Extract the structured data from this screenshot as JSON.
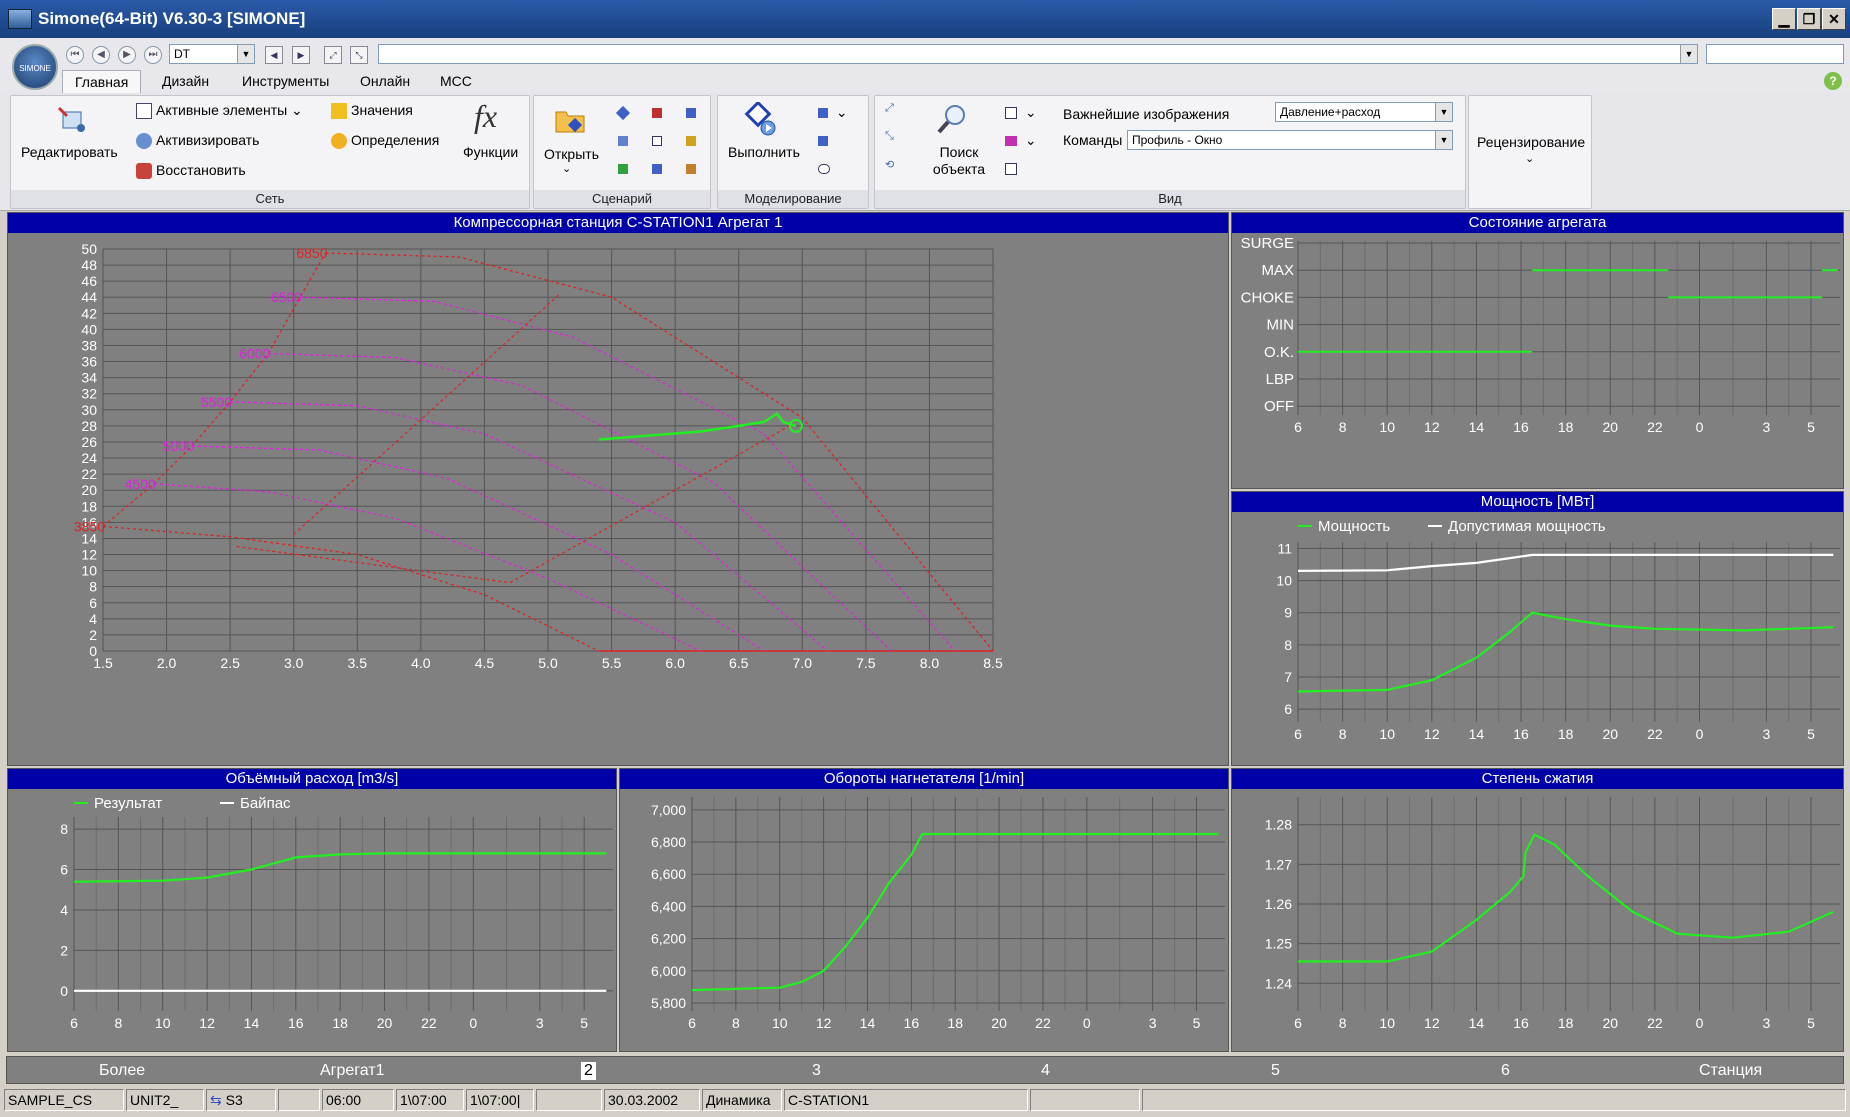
{
  "window": {
    "title": "Simone(64-Bit) V6.30-3 [SIMONE]",
    "minimize": "▁",
    "restore": "❐",
    "close": "✕"
  },
  "quickbar": {
    "mode": "DT",
    "command": ""
  },
  "menu_tabs": [
    "Главная",
    "Дизайн",
    "Инструменты",
    "Онлайн",
    "MCC"
  ],
  "ribbon": {
    "net": {
      "edit": "Редактировать",
      "active_elements": "Активные элементы",
      "activate": "Активизировать",
      "restore": "Восстановить",
      "values": "Значения",
      "definitions": "Определения",
      "functions": "Функции",
      "fx": "fx",
      "label": "Сеть"
    },
    "scenarios": {
      "open": "Открыть",
      "label": "Сценарий"
    },
    "modeling": {
      "run": "Выполнить",
      "label": "Моделирование"
    },
    "view": {
      "search": "Поиск объекта",
      "important_label": "Важнейшие изображения",
      "important_value": "Давление+расход",
      "commands_label": "Команды",
      "commands_value": "Профиль - Окно",
      "label": "Вид"
    },
    "review": {
      "label": "Рецензирование"
    }
  },
  "colors": {
    "panel_bg": "#808080",
    "panel_header": "#0000a8",
    "series_green": "#22ee22",
    "series_white": "#ffffff",
    "map_red": "#dd2222",
    "map_magenta": "#dd22dd"
  },
  "panels": {
    "compressor_map": "Компрессорная станция C-STATION1 Агрегат 1",
    "unit_state": "Состояние агрегата",
    "power": "Мощность [МВт]",
    "volume_flow": "Объёмный расход [m3/s]",
    "blower_speed": "Обороты нагнетателя [1/min]",
    "compression_ratio": "Степень сжатия"
  },
  "chart_data": [
    {
      "type": "line",
      "title": "Компрессорная станция C-STATION1 Агрегат 1",
      "xlim": [
        1.5,
        8.5
      ],
      "ylim": [
        0,
        50
      ],
      "x_ticks": [
        "1.5",
        "2.0",
        "2.5",
        "3.0",
        "3.5",
        "4.0",
        "4.5",
        "5.0",
        "5.5",
        "6.0",
        "6.5",
        "7.0",
        "7.5",
        "8.0",
        "8.5"
      ],
      "y_ticks": [
        "0",
        "2",
        "4",
        "6",
        "8",
        "10",
        "12",
        "14",
        "16",
        "18",
        "20",
        "22",
        "24",
        "26",
        "28",
        "30",
        "32",
        "34",
        "36",
        "38",
        "40",
        "42",
        "44",
        "46",
        "48",
        "50"
      ],
      "speed_lines": [
        {
          "name": "3850",
          "points": [
            [
              1.5,
              15.5
            ],
            [
              2.5,
              14.2
            ],
            [
              3.5,
              12
            ],
            [
              4.5,
              7
            ],
            [
              5.4,
              0
            ]
          ]
        },
        {
          "name": "4500",
          "points": [
            [
              1.9,
              20.8
            ],
            [
              2.8,
              19.8
            ],
            [
              3.8,
              16.5
            ],
            [
              5.0,
              9
            ],
            [
              6.2,
              0
            ]
          ]
        },
        {
          "name": "5000",
          "points": [
            [
              2.2,
              25.5
            ],
            [
              3.2,
              25
            ],
            [
              4.2,
              21.5
            ],
            [
              5.5,
              12
            ],
            [
              6.7,
              0
            ]
          ]
        },
        {
          "name": "5500",
          "points": [
            [
              2.5,
              31
            ],
            [
              3.5,
              30.5
            ],
            [
              4.5,
              27
            ],
            [
              6.0,
              16
            ],
            [
              7.2,
              0
            ]
          ]
        },
        {
          "name": "6000",
          "points": [
            [
              2.8,
              37
            ],
            [
              3.8,
              36.5
            ],
            [
              4.8,
              33
            ],
            [
              6.3,
              21
            ],
            [
              7.7,
              0
            ]
          ]
        },
        {
          "name": "6500",
          "points": [
            [
              3.05,
              44
            ],
            [
              4.1,
              43.5
            ],
            [
              5.2,
              39
            ],
            [
              6.7,
              27
            ],
            [
              8.2,
              0
            ]
          ]
        },
        {
          "name": "6850",
          "points": [
            [
              3.25,
              49.5
            ],
            [
              4.3,
              49
            ],
            [
              5.5,
              44
            ],
            [
              7.0,
              29
            ],
            [
              8.5,
              0
            ]
          ]
        }
      ],
      "operating_path": [
        [
          5.4,
          26.3
        ],
        [
          6.2,
          27.3
        ],
        [
          6.5,
          28
        ],
        [
          6.7,
          28.5
        ],
        [
          6.8,
          29.5
        ],
        [
          6.85,
          28.5
        ],
        [
          6.95,
          28
        ]
      ]
    },
    {
      "type": "line",
      "title": "Состояние агрегата",
      "states": [
        "SURGE",
        "MAX",
        "CHOKE",
        "MIN",
        "O.K.",
        "LBP",
        "OFF"
      ],
      "x_ticks": [
        "6",
        "8",
        "10",
        "12",
        "14",
        "16",
        "18",
        "20",
        "22",
        "0",
        "3",
        "5"
      ],
      "segments": [
        {
          "state": "O.K.",
          "from": 6,
          "to": 16.5
        },
        {
          "state": "MAX",
          "from": 16.5,
          "to": 22.6
        },
        {
          "state": "CHOKE",
          "from": 22.6,
          "to": 29.5
        },
        {
          "state": "MAX",
          "from": 29.5,
          "to": 30.2
        }
      ]
    },
    {
      "type": "line",
      "title": "Мощность [МВт]",
      "ylim": [
        5.6,
        11.2
      ],
      "y_ticks": [
        "6",
        "7",
        "8",
        "9",
        "10",
        "11"
      ],
      "x_ticks": [
        "6",
        "8",
        "10",
        "12",
        "14",
        "16",
        "18",
        "20",
        "22",
        "0",
        "3",
        "5"
      ],
      "series": [
        {
          "name": "Мощность",
          "points": [
            [
              6,
              6.55
            ],
            [
              10,
              6.6
            ],
            [
              12,
              6.9
            ],
            [
              14,
              7.6
            ],
            [
              15.5,
              8.4
            ],
            [
              16.5,
              9.0
            ],
            [
              18,
              8.8
            ],
            [
              20,
              8.6
            ],
            [
              22,
              8.5
            ],
            [
              26,
              8.45
            ],
            [
              30,
              8.55
            ]
          ]
        },
        {
          "name": "Допустимая мощность",
          "points": [
            [
              6,
              10.3
            ],
            [
              10,
              10.32
            ],
            [
              12,
              10.45
            ],
            [
              14,
              10.55
            ],
            [
              15.5,
              10.7
            ],
            [
              16.5,
              10.8
            ],
            [
              20,
              10.8
            ],
            [
              30,
              10.8
            ]
          ]
        }
      ]
    },
    {
      "type": "line",
      "title": "Объёмный расход [m3/s]",
      "ylim": [
        -1,
        8.6
      ],
      "y_ticks": [
        "0",
        "2",
        "4",
        "6",
        "8"
      ],
      "x_ticks": [
        "6",
        "8",
        "10",
        "12",
        "14",
        "16",
        "18",
        "20",
        "22",
        "0",
        "3",
        "5"
      ],
      "series": [
        {
          "name": "Результат",
          "points": [
            [
              6,
              5.4
            ],
            [
              10,
              5.45
            ],
            [
              12,
              5.6
            ],
            [
              14,
              6.0
            ],
            [
              16,
              6.6
            ],
            [
              18,
              6.75
            ],
            [
              20,
              6.8
            ],
            [
              30,
              6.8
            ]
          ]
        },
        {
          "name": "Байпас",
          "points": [
            [
              6,
              0
            ],
            [
              30,
              0
            ]
          ]
        }
      ]
    },
    {
      "type": "line",
      "title": "Обороты нагнетателя [1/min]",
      "ylim": [
        5750,
        7080
      ],
      "y_ticks": [
        "5,800",
        "6,000",
        "6,200",
        "6,400",
        "6,600",
        "6,800",
        "7,000"
      ],
      "x_ticks": [
        "6",
        "8",
        "10",
        "12",
        "14",
        "16",
        "18",
        "20",
        "22",
        "0",
        "3",
        "5"
      ],
      "series": [
        {
          "name": "",
          "points": [
            [
              6,
              5880
            ],
            [
              10,
              5895
            ],
            [
              11,
              5930
            ],
            [
              12,
              6000
            ],
            [
              13,
              6150
            ],
            [
              14,
              6330
            ],
            [
              15,
              6550
            ],
            [
              16,
              6720
            ],
            [
              16.5,
              6850
            ],
            [
              18,
              6850
            ],
            [
              30,
              6850
            ]
          ]
        }
      ]
    },
    {
      "type": "line",
      "title": "Степень сжатия",
      "ylim": [
        1.233,
        1.287
      ],
      "y_ticks": [
        "1.24",
        "1.25",
        "1.26",
        "1.27",
        "1.28"
      ],
      "x_ticks": [
        "6",
        "8",
        "10",
        "12",
        "14",
        "16",
        "18",
        "20",
        "22",
        "0",
        "3",
        "5"
      ],
      "series": [
        {
          "name": "",
          "points": [
            [
              6,
              1.2455
            ],
            [
              10,
              1.2455
            ],
            [
              12,
              1.248
            ],
            [
              14,
              1.256
            ],
            [
              15.5,
              1.263
            ],
            [
              16.1,
              1.267
            ],
            [
              16.2,
              1.273
            ],
            [
              16.6,
              1.2775
            ],
            [
              17.5,
              1.275
            ],
            [
              19,
              1.267
            ],
            [
              21,
              1.258
            ],
            [
              23,
              1.2525
            ],
            [
              25.5,
              1.2515
            ],
            [
              28,
              1.253
            ],
            [
              30,
              1.258
            ]
          ]
        }
      ]
    }
  ],
  "status_bar1": {
    "more": "Более",
    "unit": "Агрегат1",
    "p2": "2",
    "p3": "3",
    "p4": "4",
    "p5": "5",
    "p6": "6",
    "station": "Станция"
  },
  "status_bar2": {
    "case": "SAMPLE_CS",
    "unit": "UNIT2_",
    "scenario": "S3",
    "time1": "06:00",
    "time2": "1\\07:00",
    "time3": "1\\07:00|",
    "date": "30.03.2002",
    "mode": "Динамика",
    "station": "C-STATION1"
  }
}
